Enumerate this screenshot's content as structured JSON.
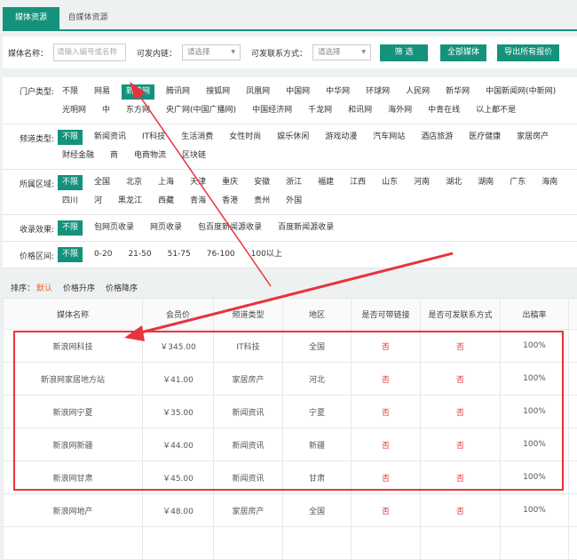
{
  "tabs": [
    "媒体资源",
    "自媒体资源"
  ],
  "filter": {
    "name_label": "媒体名称：",
    "name_placeholder": "请输入编号或名称",
    "link_label": "可发内链：",
    "link_value": "请选择",
    "contact_label": "可发联系方式：",
    "contact_value": "请选择",
    "filter_btn": "筛 选",
    "all_btn": "全部媒体",
    "export_btn": "导出所有报价"
  },
  "groups": [
    {
      "label": "门户类型:",
      "options": [
        "不限",
        "网易",
        "新浪网",
        "腾讯网",
        "搜狐网",
        "凤凰网",
        "中国网",
        "中华网",
        "环球网",
        "人民网",
        "新华网",
        "中国新闻网(中新网)",
        "光明网",
        "中",
        "东方网",
        "央广网(中国广播网)",
        "中国经济网",
        "千龙网",
        "和讯网",
        "海外网",
        "中青在线",
        "以上都不是"
      ],
      "selected": 2
    },
    {
      "label": "频道类型:",
      "options": [
        "不限",
        "新闻资讯",
        "IT科技",
        "生活消费",
        "女性时尚",
        "娱乐休闲",
        "游戏动漫",
        "汽车网站",
        "酒店旅游",
        "医疗健康",
        "家居房产",
        "财经金融",
        "商",
        "电商物流",
        "区块链"
      ],
      "selected": 0
    },
    {
      "label": "所属区域:",
      "options": [
        "不限",
        "全国",
        "北京",
        "上海",
        "天津",
        "重庆",
        "安徽",
        "浙江",
        "福建",
        "江西",
        "山东",
        "河南",
        "湖北",
        "湖南",
        "广东",
        "海南",
        "四川",
        "河",
        "黑龙江",
        "西藏",
        "青海",
        "香港",
        "贵州",
        "外国"
      ],
      "selected": 0
    },
    {
      "label": "收录效果:",
      "options": [
        "不限",
        "包网页收录",
        "网页收录",
        "包百度新闻源收录",
        "百度新闻源收录"
      ],
      "selected": 0
    },
    {
      "label": "价格区间:",
      "options": [
        "不限",
        "0-20",
        "21-50",
        "51-75",
        "76-100",
        "100以上"
      ],
      "selected": 0
    }
  ],
  "sort": {
    "label": "排序：",
    "options": [
      "默认",
      "价格升序",
      "价格降序"
    ]
  },
  "table": {
    "headers": [
      "媒体名称",
      "会员价",
      "频道类型",
      "地区",
      "是否可带链接",
      "是否可发联系方式",
      "出稿率"
    ],
    "rows": [
      [
        "新浪网科技",
        "￥345.00",
        "IT科技",
        "全国",
        "否",
        "否",
        "100%"
      ],
      [
        "新浪网家居地方站",
        "￥41.00",
        "家居房产",
        "河北",
        "否",
        "否",
        "100%"
      ],
      [
        "新浪网宁夏",
        "￥35.00",
        "新闻资讯",
        "宁夏",
        "否",
        "否",
        "100%"
      ],
      [
        "新浪网新疆",
        "￥44.00",
        "新闻资讯",
        "新疆",
        "否",
        "否",
        "100%"
      ],
      [
        "新浪网甘肃",
        "￥45.00",
        "新闻资讯",
        "甘肃",
        "否",
        "否",
        "100%"
      ],
      [
        "新浪网地产",
        "￥48.00",
        "家居房产",
        "全国",
        "否",
        "否",
        "100%"
      ]
    ]
  },
  "colors": {
    "accent": "#14927c",
    "annotation": "#e8333b",
    "sort_active": "#e8632b"
  }
}
